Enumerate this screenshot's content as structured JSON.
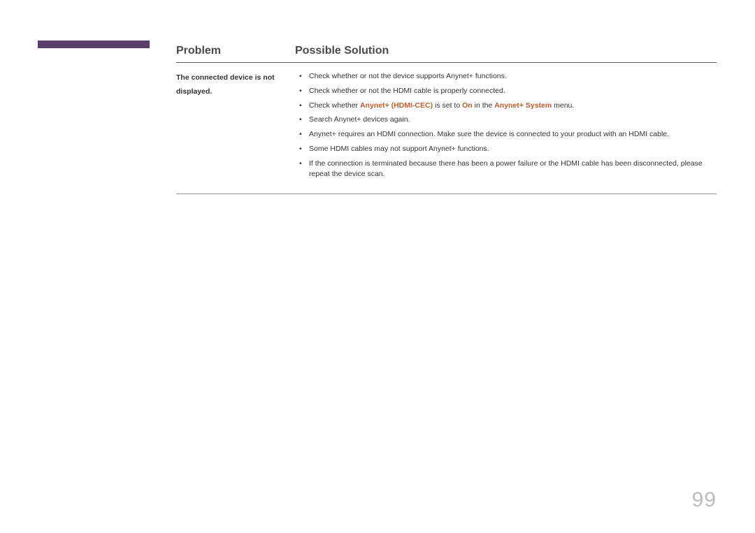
{
  "table": {
    "headers": {
      "problem": "Problem",
      "solution": "Possible Solution"
    },
    "row": {
      "problem_line1": "The connected device is not",
      "problem_line2": "displayed.",
      "solutions": {
        "item0": "Check whether or not the device supports Anynet+ functions.",
        "item1": "Check whether or not the HDMI cable is properly connected.",
        "item2_prefix": "Check whether ",
        "item2_accent1": "Anynet+ (HDMI-CEC)",
        "item2_mid1": " is set to ",
        "item2_accent2": "On",
        "item2_mid2": " in the ",
        "item2_accent3": "Anynet+ System",
        "item2_suffix": " menu.",
        "item3": "Search Anynet+ devices again.",
        "item4": "Anynet+ requires an HDMI connection. Make sure the device is connected to your product with an HDMI cable.",
        "item5": "Some HDMI cables may not support Anynet+ functions.",
        "item6": "If the connection is terminated because there has been a power failure or the HDMI cable has been disconnected, please repeat the device scan."
      }
    }
  },
  "page_number": "99"
}
